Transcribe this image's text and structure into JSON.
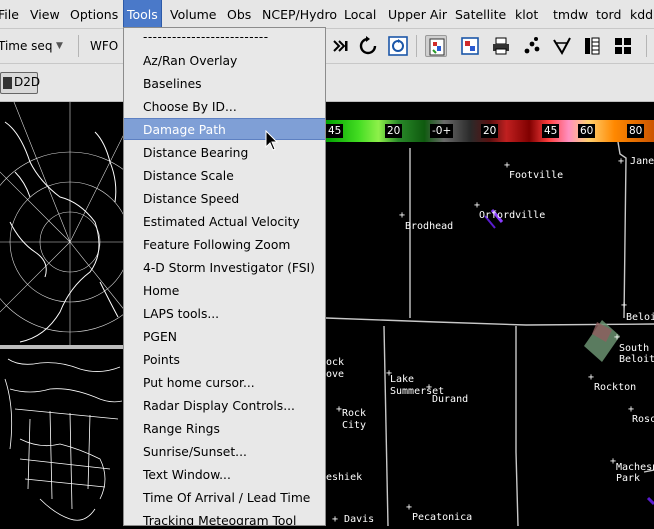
{
  "menubar": {
    "items": [
      "File",
      "View",
      "Options",
      "Tools",
      "Volume",
      "Obs",
      "NCEP/Hydro",
      "Local",
      "Upper Air",
      "Satellite",
      "klot",
      "tmdw",
      "tord",
      "kdd"
    ]
  },
  "toolbar": {
    "time_combo": "Time seq",
    "wfo_label": "WFO"
  },
  "toolbar2": {
    "d2d_label": "D2D"
  },
  "tools_menu": {
    "separator": "--------------------------",
    "items": [
      "Az/Ran Overlay",
      "Baselines",
      "Choose By ID...",
      "Damage Path",
      "Distance Bearing",
      "Distance Scale",
      "Distance Speed",
      "Estimated Actual Velocity",
      "Feature Following Zoom",
      "4-D Storm Investigator (FSI)",
      "Home",
      "LAPS tools...",
      "PGEN",
      "Points",
      "Put home cursor...",
      "Radar Display Controls...",
      "Range Rings",
      "Sunrise/Sunset...",
      "Text Window...",
      "Time Of Arrival / Lead Time",
      "Tracking Meteogram Tool"
    ],
    "hover_index": 3
  },
  "colorbar": {
    "labels": [
      "45",
      "20",
      "-0+",
      "20",
      "45",
      "60",
      "80"
    ]
  },
  "map": {
    "cities": [
      {
        "name": "Janes",
        "plus": true
      },
      {
        "name": "Footville",
        "plus": true
      },
      {
        "name": "Orfordville",
        "plus": true
      },
      {
        "name": "Brodhead",
        "plus": true
      },
      {
        "name": "Beloit",
        "plus": true
      },
      {
        "name": "South",
        "plus": true
      },
      {
        "name": "Beloit",
        "plus": false
      },
      {
        "name": "Rockton",
        "plus": true
      },
      {
        "name": "Lake",
        "plus": true
      },
      {
        "name": "Summerset",
        "plus": false
      },
      {
        "name": "Durand",
        "plus": true
      },
      {
        "name": "Rock",
        "plus": true
      },
      {
        "name": "City",
        "plus": false
      },
      {
        "name": "Rosc",
        "plus": true
      },
      {
        "name": "Machesney",
        "plus": true
      },
      {
        "name": "Park",
        "plus": false
      },
      {
        "name": "ock",
        "plus": false
      },
      {
        "name": "ove",
        "plus": false
      },
      {
        "name": "eshiek",
        "plus": false
      },
      {
        "name": "Pecatonica",
        "plus": true
      },
      {
        "name": "Davis",
        "plus": true
      }
    ]
  },
  "colors": {
    "menu_bg": "#e8e8e8",
    "menu_hover": "#7f9fd6",
    "menubar_active": "#4a79c9",
    "map_bg": "#000000",
    "boundary": "#c8c8c8"
  }
}
